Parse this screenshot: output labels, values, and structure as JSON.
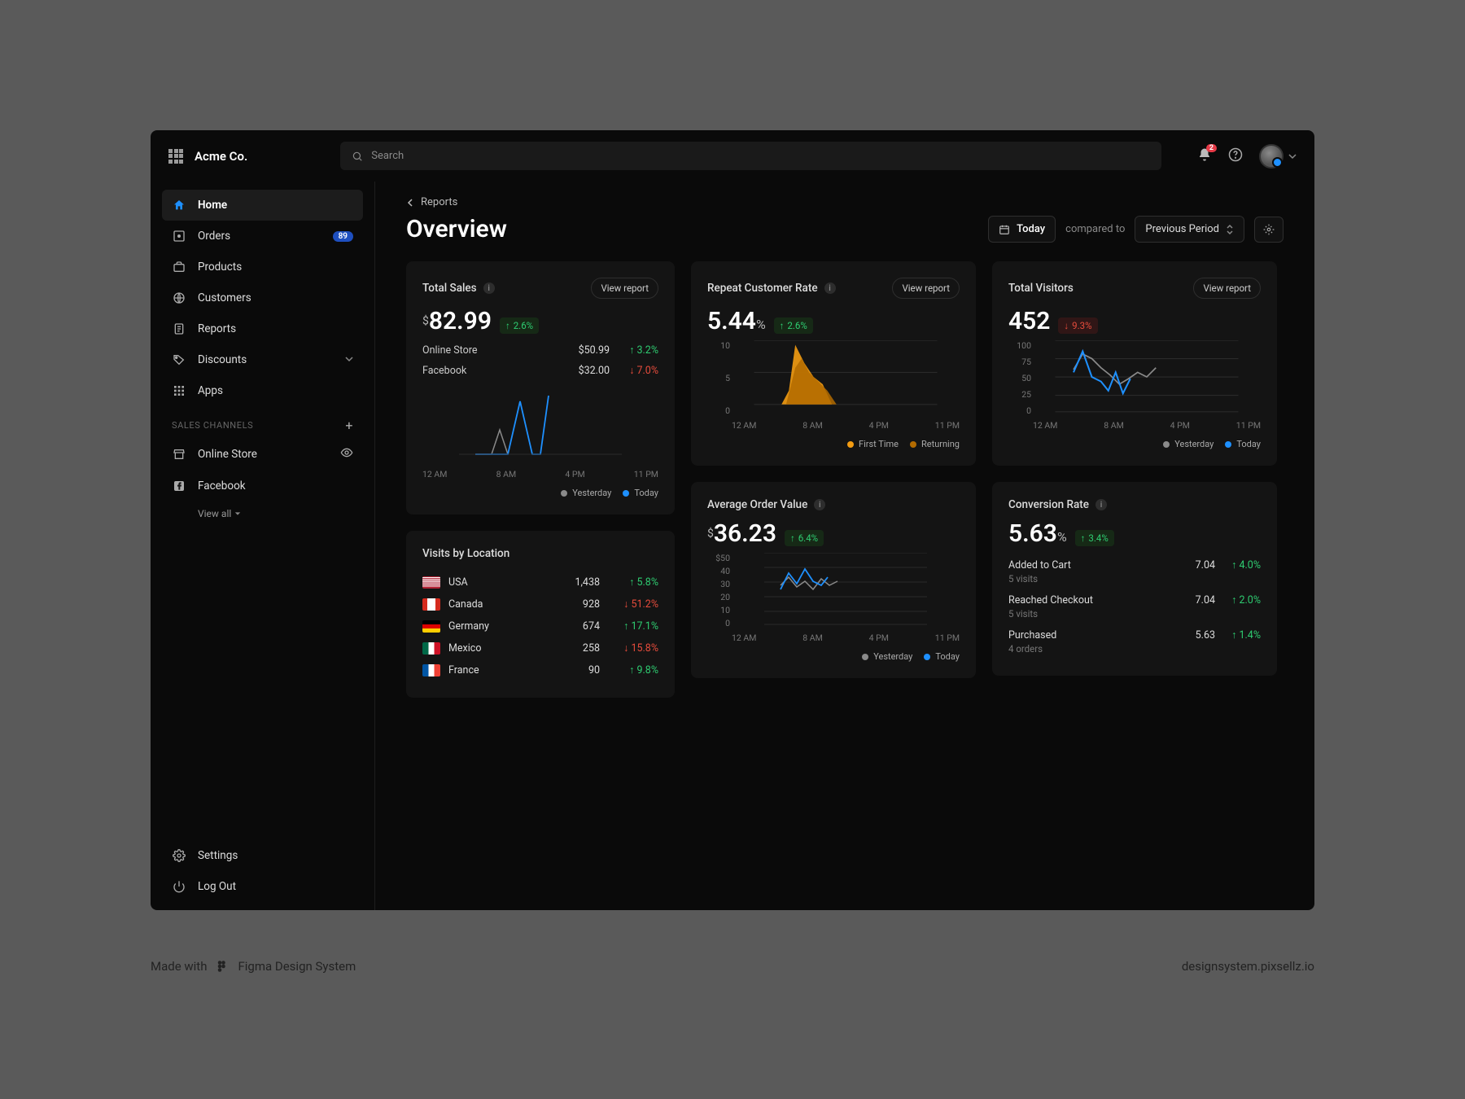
{
  "app": {
    "company": "Acme Co."
  },
  "search": {
    "placeholder": "Search"
  },
  "notifications": {
    "count": "2"
  },
  "sidebar": {
    "items": [
      {
        "label": "Home",
        "icon": "home",
        "active": true
      },
      {
        "label": "Orders",
        "icon": "inbox",
        "badge": "89"
      },
      {
        "label": "Products",
        "icon": "briefcase"
      },
      {
        "label": "Customers",
        "icon": "globe"
      },
      {
        "label": "Reports",
        "icon": "clipboard"
      },
      {
        "label": "Discounts",
        "icon": "tag",
        "chevron": true
      },
      {
        "label": "Apps",
        "icon": "grid"
      }
    ],
    "section_label": "SALES CHANNELS",
    "channels": [
      {
        "label": "Online Store",
        "icon": "store",
        "tail": "eye"
      },
      {
        "label": "Facebook",
        "icon": "facebook"
      }
    ],
    "view_all": "View all",
    "footer": [
      {
        "label": "Settings",
        "icon": "gear"
      },
      {
        "label": "Log Out",
        "icon": "power"
      }
    ]
  },
  "breadcrumb": "Reports",
  "page_title": "Overview",
  "controls": {
    "date_label": "Today",
    "compared_label": "compared to",
    "period_label": "Previous Period"
  },
  "cards": {
    "total_sales": {
      "title": "Total Sales",
      "view": "View report",
      "currency": "$",
      "value": "82.99",
      "delta": "2.6%",
      "delta_dir": "up",
      "rows": [
        {
          "label": "Online Store",
          "value": "$50.99",
          "delta": "3.2%",
          "dir": "up"
        },
        {
          "label": "Facebook",
          "value": "$32.00",
          "delta": "7.0%",
          "dir": "down"
        }
      ],
      "x_ticks": [
        "12 AM",
        "8 AM",
        "4 PM",
        "11 PM"
      ],
      "legend": [
        {
          "label": "Yesterday",
          "color": "#8a8a8a"
        },
        {
          "label": "Today",
          "color": "#1e90ff"
        }
      ]
    },
    "repeat": {
      "title": "Repeat Customer Rate",
      "view": "View report",
      "value": "5.44",
      "suffix": "%",
      "delta": "2.6%",
      "delta_dir": "up",
      "y_ticks": [
        "10",
        "5",
        "0"
      ],
      "x_ticks": [
        "12 AM",
        "8 AM",
        "4 PM",
        "11 PM"
      ],
      "legend": [
        {
          "label": "First Time",
          "color": "#f39c12"
        },
        {
          "label": "Returning",
          "color": "#c47a00"
        }
      ]
    },
    "visitors": {
      "title": "Total Visitors",
      "view": "View report",
      "value": "452",
      "delta": "9.3%",
      "delta_dir": "down",
      "y_ticks": [
        "100",
        "75",
        "50",
        "25",
        "0"
      ],
      "x_ticks": [
        "12 AM",
        "8 AM",
        "4 PM",
        "11 PM"
      ],
      "legend": [
        {
          "label": "Yesterday",
          "color": "#8a8a8a"
        },
        {
          "label": "Today",
          "color": "#1e90ff"
        }
      ]
    },
    "locations": {
      "title": "Visits by Location",
      "rows": [
        {
          "flag": "us",
          "label": "USA",
          "value": "1,438",
          "delta": "5.8%",
          "dir": "up"
        },
        {
          "flag": "ca",
          "label": "Canada",
          "value": "928",
          "delta": "51.2%",
          "dir": "down"
        },
        {
          "flag": "de",
          "label": "Germany",
          "value": "674",
          "delta": "17.1%",
          "dir": "up"
        },
        {
          "flag": "mx",
          "label": "Mexico",
          "value": "258",
          "delta": "15.8%",
          "dir": "down"
        },
        {
          "flag": "fr",
          "label": "France",
          "value": "90",
          "delta": "9.8%",
          "dir": "up"
        }
      ]
    },
    "aov": {
      "title": "Average Order Value",
      "currency": "$",
      "value": "36.23",
      "delta": "6.4%",
      "delta_dir": "up",
      "y_ticks": [
        "$50",
        "40",
        "30",
        "20",
        "10",
        "0"
      ],
      "x_ticks": [
        "12 AM",
        "8 AM",
        "4 PM",
        "11 PM"
      ],
      "legend": [
        {
          "label": "Yesterday",
          "color": "#8a8a8a"
        },
        {
          "label": "Today",
          "color": "#1e90ff"
        }
      ]
    },
    "conversion": {
      "title": "Conversion Rate",
      "value": "5.63",
      "suffix": "%",
      "delta": "3.4%",
      "delta_dir": "up",
      "rows": [
        {
          "label": "Added to Cart",
          "sub": "5 visits",
          "value": "7.04",
          "delta": "4.0%",
          "dir": "up"
        },
        {
          "label": "Reached Checkout",
          "sub": "5 visits",
          "value": "7.04",
          "delta": "2.0%",
          "dir": "up"
        },
        {
          "label": "Purchased",
          "sub": "4 orders",
          "value": "5.63",
          "delta": "1.4%",
          "dir": "up"
        }
      ]
    }
  },
  "chart_data": [
    {
      "name": "total_sales",
      "type": "line",
      "x": [
        "12 AM",
        "8 AM",
        "4 PM",
        "11 PM"
      ],
      "series": [
        {
          "name": "Yesterday",
          "values": [
            0,
            0.3,
            0,
            0,
            0,
            0,
            0
          ]
        },
        {
          "name": "Today",
          "values": [
            0,
            0,
            0.8,
            0,
            0.95,
            null,
            null
          ]
        }
      ],
      "ylim": [
        0,
        1
      ]
    },
    {
      "name": "repeat_customer_rate",
      "type": "area",
      "x": [
        "12 AM",
        "8 AM",
        "4 PM",
        "11 PM"
      ],
      "series": [
        {
          "name": "First Time",
          "values": [
            0,
            2,
            10,
            7,
            4,
            3,
            0,
            0
          ]
        },
        {
          "name": "Returning",
          "values": [
            0,
            1,
            6,
            7,
            5,
            3,
            0,
            0
          ]
        }
      ],
      "ylim": [
        0,
        10
      ]
    },
    {
      "name": "total_visitors",
      "type": "line",
      "x": [
        "12 AM",
        "8 AM",
        "4 PM",
        "11 PM"
      ],
      "series": [
        {
          "name": "Yesterday",
          "values": [
            60,
            80,
            70,
            55,
            45,
            35,
            40,
            50,
            45,
            55
          ]
        },
        {
          "name": "Today",
          "values": [
            55,
            78,
            50,
            42,
            30,
            48,
            25,
            40,
            null,
            null
          ]
        }
      ],
      "ylim": [
        0,
        100
      ]
    },
    {
      "name": "average_order_value",
      "type": "line",
      "x": [
        "12 AM",
        "8 AM",
        "4 PM",
        "11 PM"
      ],
      "series": [
        {
          "name": "Yesterday",
          "values": [
            30,
            34,
            28,
            32,
            27,
            33,
            29,
            35
          ]
        },
        {
          "name": "Today",
          "values": [
            28,
            36,
            30,
            38,
            32,
            30,
            null,
            null
          ]
        }
      ],
      "ylim": [
        0,
        50
      ]
    }
  ],
  "credits": {
    "made_with": "Made with",
    "system": "Figma Design System",
    "url": "designsystem.pixsellz.io"
  }
}
